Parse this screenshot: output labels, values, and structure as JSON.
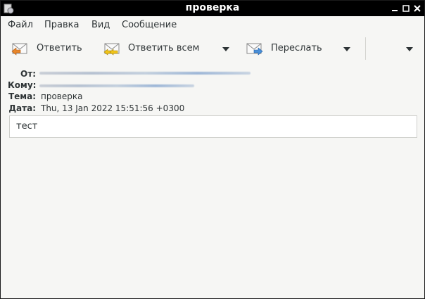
{
  "window": {
    "title": "проверка"
  },
  "menubar": {
    "items": [
      "Файл",
      "Правка",
      "Вид",
      "Сообщение"
    ]
  },
  "toolbar": {
    "reply_label": "Ответить",
    "reply_all_label": "Ответить всем",
    "forward_label": "Переслать"
  },
  "headers": {
    "from_label": "От:",
    "to_label": "Кому:",
    "subject_label": "Тема:",
    "subject_value": "проверка",
    "date_label": "Дата:",
    "date_value": "Thu, 13 Jan 2022 15:51:56 +0300"
  },
  "message": {
    "body": "тест"
  },
  "icons": {
    "reply": "mail-reply-icon",
    "reply_all": "mail-reply-all-icon",
    "forward": "mail-forward-icon"
  }
}
